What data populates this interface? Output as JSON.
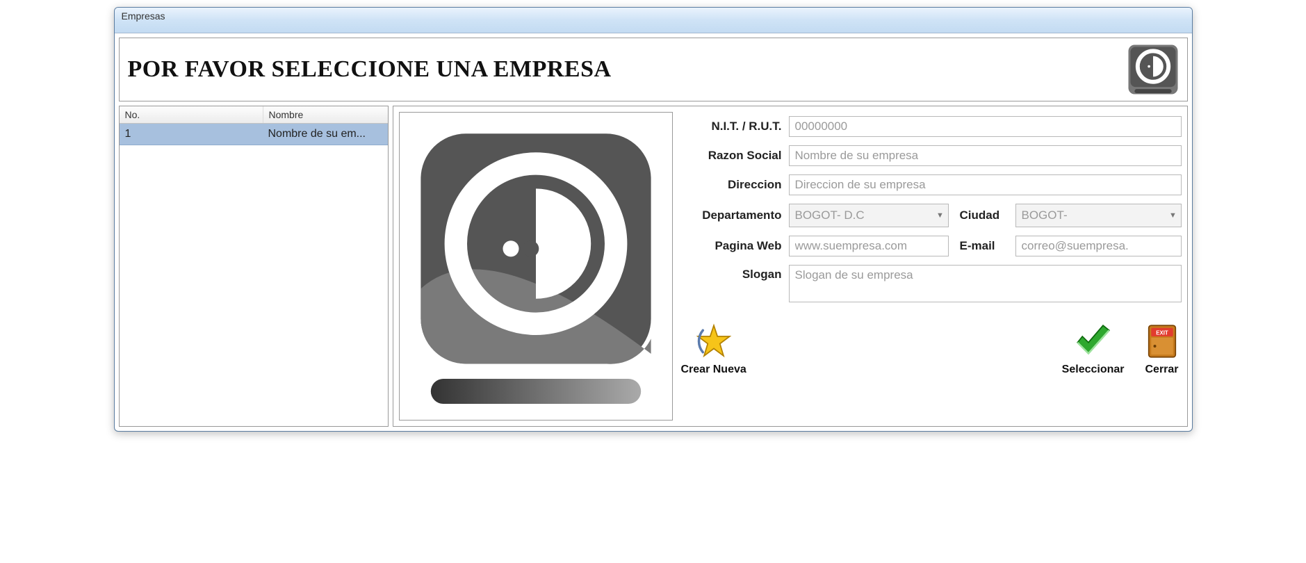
{
  "window": {
    "title": "Empresas"
  },
  "header": {
    "title": "POR FAVOR SELECCIONE UNA EMPRESA"
  },
  "list": {
    "columns": {
      "no": "No.",
      "nombre": "Nombre"
    },
    "rows": [
      {
        "no": "1",
        "nombre": "Nombre de su em..."
      }
    ]
  },
  "form": {
    "labels": {
      "nit": "N.I.T. / R.U.T.",
      "razon": "Razon Social",
      "direccion": "Direccion",
      "departamento": "Departamento",
      "ciudad": "Ciudad",
      "web": "Pagina Web",
      "email": "E-mail",
      "slogan": "Slogan"
    },
    "values": {
      "nit": "00000000",
      "razon": "Nombre de su empresa",
      "direccion": "Direccion de su empresa",
      "departamento": "BOGOT- D.C",
      "ciudad": "BOGOT-",
      "web": "www.suempresa.com",
      "email": "correo@suempresa.",
      "slogan": "Slogan de su empresa"
    }
  },
  "buttons": {
    "crear": "Crear Nueva",
    "seleccionar": "Seleccionar",
    "cerrar": "Cerrar"
  }
}
